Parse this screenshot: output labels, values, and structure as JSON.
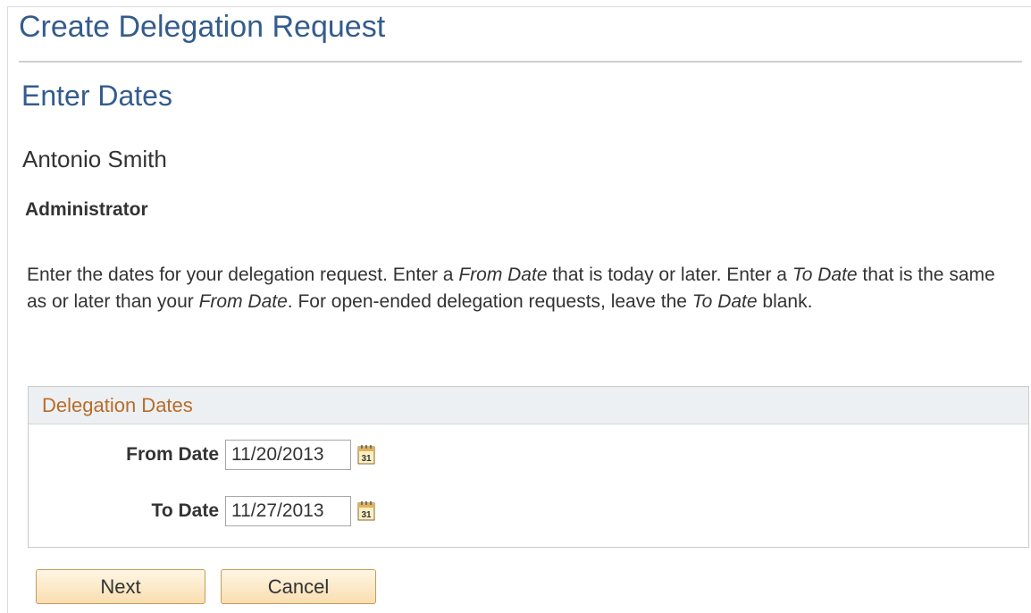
{
  "page": {
    "title": "Create Delegation Request",
    "section_title": "Enter Dates",
    "employee_name": "Antonio Smith",
    "employee_role": "Administrator"
  },
  "instructions": {
    "p1": "Enter the dates for your delegation request. Enter a ",
    "em1": "From Date",
    "p2": " that is today or later. Enter a ",
    "em2": "To Date",
    "p3": " that is the same as or later than your ",
    "em3": "From Date",
    "p4": ". For open-ended delegation requests, leave the ",
    "em4": "To Date",
    "p5": " blank."
  },
  "delegation_dates": {
    "header": "Delegation Dates",
    "from_label": "From Date",
    "from_value": "11/20/2013",
    "to_label": "To Date",
    "to_value": "11/27/2013",
    "calendar_icon_text": "31"
  },
  "buttons": {
    "next": "Next",
    "cancel": "Cancel"
  },
  "colors": {
    "heading_blue": "#345c8c",
    "group_header_text": "#b86c2a",
    "button_border": "#c69a5d"
  }
}
